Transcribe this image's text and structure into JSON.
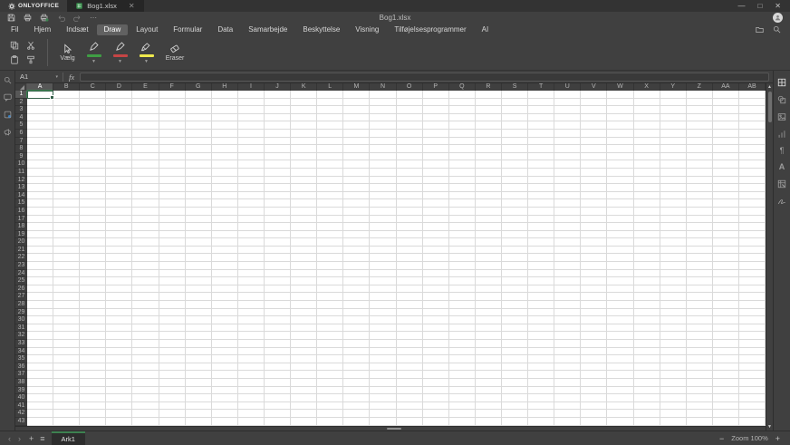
{
  "titlebar": {
    "app_name": "ONLYOFFICE",
    "doc_tab": "Bog1.xlsx",
    "tab_close": "✕",
    "window_controls": {
      "minimize": "—",
      "maximize": "□",
      "close": "✕"
    }
  },
  "quickbar": {
    "title": "Bog1.xlsx",
    "more": "⋯"
  },
  "menubar": {
    "items": [
      "Fil",
      "Hjem",
      "Indsæt",
      "Draw",
      "Layout",
      "Formular",
      "Data",
      "Samarbejde",
      "Beskyttelse",
      "Visning",
      "Tilføjelsesprogrammer",
      "AI"
    ],
    "active_index": 3
  },
  "toolbar": {
    "select_label": "Vælg",
    "eraser_label": "Eraser",
    "pens": [
      {
        "name": "pen-green",
        "color": "#3f9e44"
      },
      {
        "name": "pen-red",
        "color": "#c64545"
      },
      {
        "name": "highlighter-yellow",
        "color": "#efe94d"
      }
    ],
    "clipboard_icons": [
      "copy-icon",
      "cut-icon",
      "paste-icon",
      "copy-style-icon"
    ]
  },
  "formula_bar": {
    "cell_ref": "A1",
    "caret": "▾",
    "fx_label": "fx",
    "formula_value": ""
  },
  "sheet": {
    "columns": [
      "A",
      "B",
      "C",
      "D",
      "E",
      "F",
      "G",
      "H",
      "I",
      "J",
      "K",
      "L",
      "M",
      "N",
      "O",
      "P",
      "Q",
      "R",
      "S",
      "T",
      "U",
      "V",
      "W",
      "X",
      "Y",
      "Z",
      "AA",
      "AB"
    ],
    "visible_rows": 43,
    "selected_cell": "A1",
    "selected_column": "A",
    "selected_row": "1"
  },
  "left_panel_icons": [
    "search-icon",
    "comments-icon",
    "chat-icon",
    "feedback-icon"
  ],
  "right_panel_icons": [
    "cell-settings-icon",
    "shape-settings-icon",
    "image-settings-icon",
    "chart-settings-icon",
    "paragraph-settings-icon",
    "text-art-settings-icon",
    "pivot-table-settings-icon",
    "signature-settings-icon"
  ],
  "statusbar": {
    "prev": "‹",
    "next": "›",
    "add_sheet": "+",
    "sheet_list": "≡",
    "sheet_tab": "Ark1",
    "zoom_out": "−",
    "zoom_label": "Zoom 100%",
    "zoom_in": "+"
  },
  "colors": {
    "accent_green": "#3d8150",
    "selection_border": "#35604a",
    "toolbar_bg": "#404040",
    "titlebar_bg": "#333333",
    "grid_line": "#dadada"
  }
}
